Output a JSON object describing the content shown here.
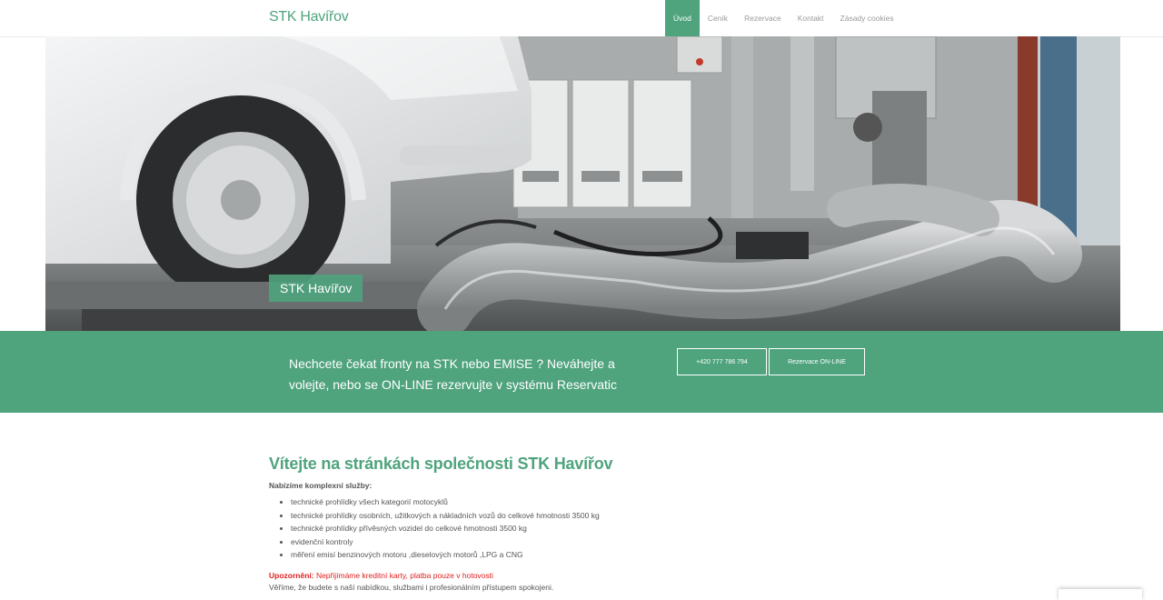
{
  "header": {
    "brand": "STK Havířov",
    "nav": [
      {
        "label": "Úvod",
        "active": true
      },
      {
        "label": "Ceník",
        "active": false
      },
      {
        "label": "Rezervace",
        "active": false
      },
      {
        "label": "Kontakt",
        "active": false
      },
      {
        "label": "Zásady cookies",
        "active": false
      }
    ]
  },
  "hero": {
    "badge": "STK Havířov"
  },
  "cta": {
    "text": "Nechcete čekat fronty na STK nebo EMISE ? Neváhejte a volejte, nebo se ON-LINE rezervujte v systému Reservatic",
    "phone_button": "+420 777 786 794",
    "reserve_button": "Rezervace ON-LINE"
  },
  "main": {
    "title": "Vítejte na stránkách společnosti STK Havířov",
    "subtitle": "Nabízíme komplexní služby:",
    "services": [
      "technické prohlídky všech kategorií motocyklů",
      "technické prohlídky osobních, užitkových a nákladních vozů do celkové hmotnosti 3500 kg",
      "technické prohlídky přívěsných vozidel do celkové hmotnosti 3500 kg",
      "evidenční kontroly",
      "měření emisí benzinových motoru ,dieselových motorů ,LPG a CNG"
    ],
    "warning_label": "Upozornění:",
    "warning_text": " Nepřijímáme kreditní karty, platba pouze v hotovosti",
    "closing": "Věříme, že budete s naší nabídkou, službami i profesionálním přístupem spokojeni."
  },
  "colors": {
    "accent": "#4fa37d",
    "warning": "#e02020"
  }
}
